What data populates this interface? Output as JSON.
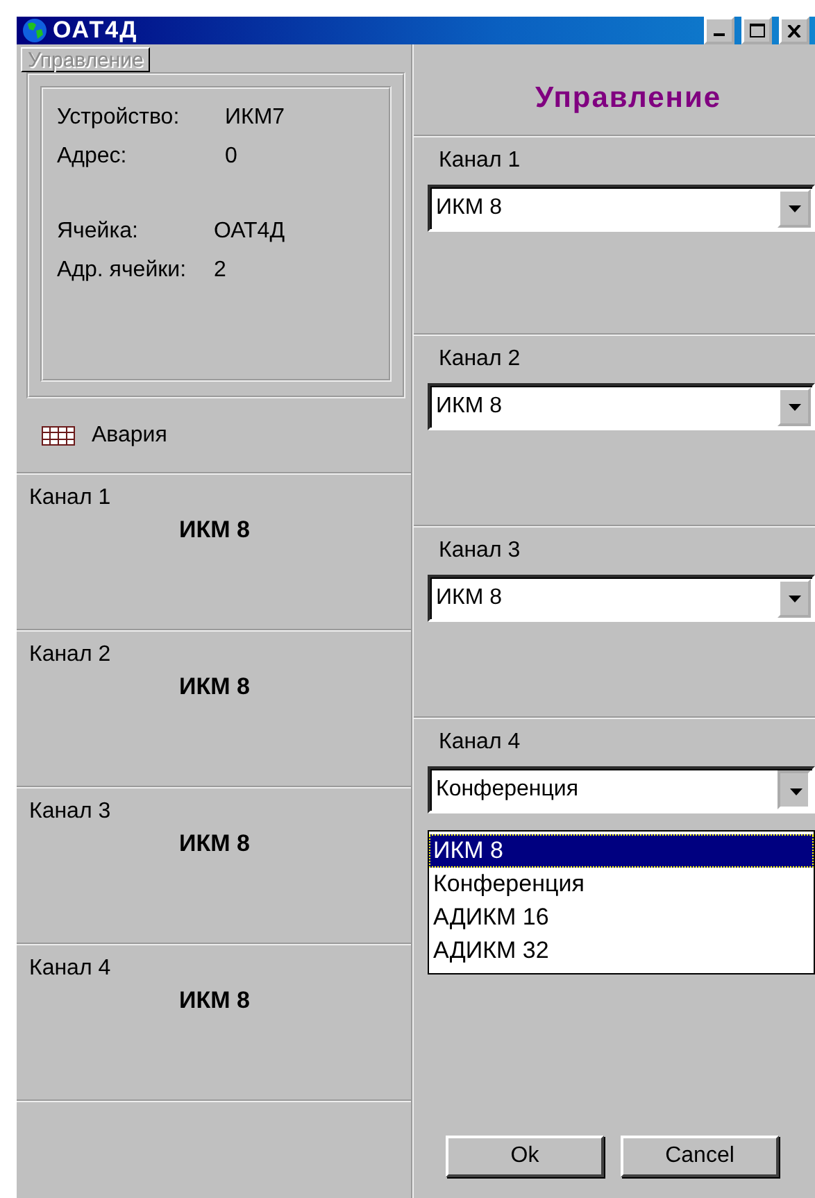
{
  "window": {
    "title": "ОАТ4Д"
  },
  "left": {
    "tab_button": {
      "label": "Управление",
      "disabled": true
    },
    "device_info": [
      {
        "label": "Устройство:",
        "value": "ИКМ7"
      },
      {
        "label": "Адрес:",
        "value": "0"
      },
      {
        "label": "Ячейка:",
        "value": "ОАТ4Д"
      },
      {
        "label": "Адр. ячейки:",
        "value": "2"
      }
    ],
    "alarm": {
      "label": "Авария"
    },
    "channels": [
      {
        "name": "Канал 1",
        "value": "ИКМ 8"
      },
      {
        "name": "Канал 2",
        "value": "ИКМ 8"
      },
      {
        "name": "Канал 3",
        "value": "ИКМ 8"
      },
      {
        "name": "Канал 4",
        "value": "ИКМ 8"
      }
    ]
  },
  "right": {
    "title": "Управление",
    "channels": [
      {
        "label": "Канал 1",
        "value": "ИКМ 8",
        "expanded": false
      },
      {
        "label": "Канал 2",
        "value": "ИКМ 8",
        "expanded": false
      },
      {
        "label": "Канал 3",
        "value": "ИКМ 8",
        "expanded": false
      },
      {
        "label": "Канал 4",
        "value": "Конференция",
        "expanded": true
      }
    ],
    "dropdown_options": [
      {
        "label": "ИКМ 8",
        "selected": true
      },
      {
        "label": "Конференция",
        "selected": false
      },
      {
        "label": "АДИКМ 16",
        "selected": false
      },
      {
        "label": "АДИКМ 32",
        "selected": false
      }
    ],
    "buttons": [
      "Ok",
      "Cancel"
    ]
  }
}
